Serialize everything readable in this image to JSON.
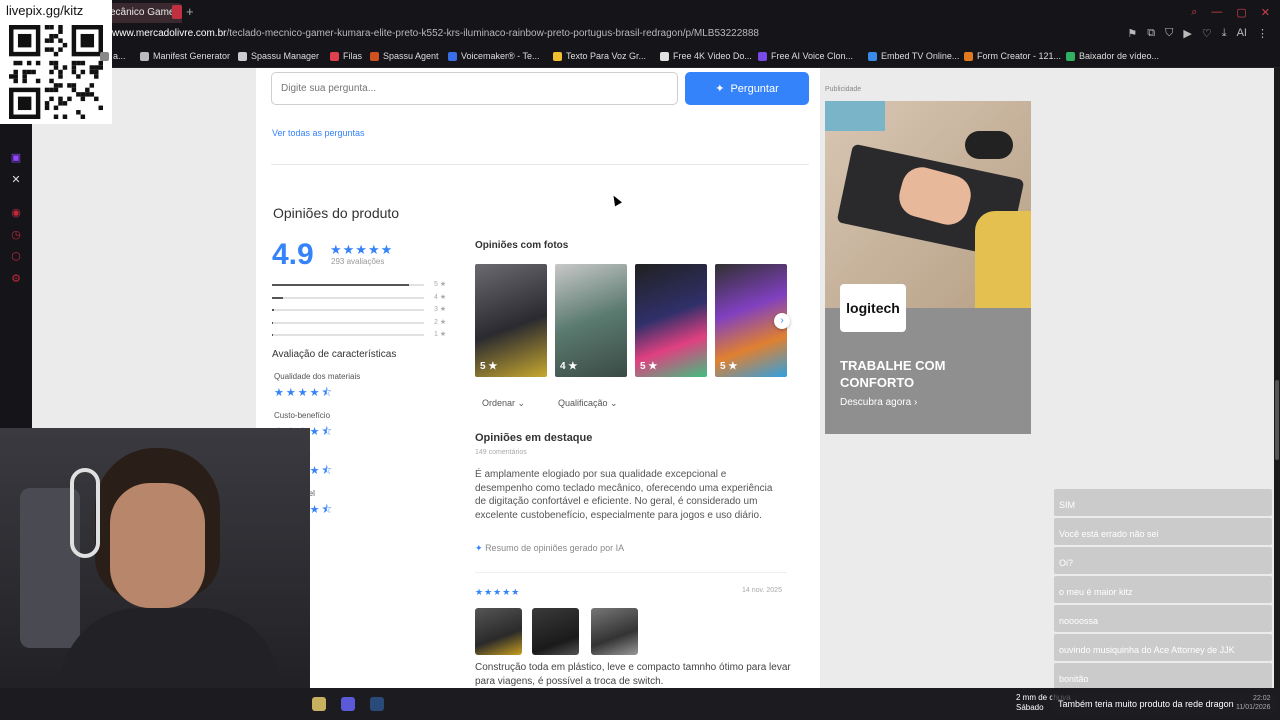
{
  "browser": {
    "tab_title": "ecânico Gamer |",
    "new_tab": "+",
    "url_host": "www.mercadolivre.com.br",
    "url_path": "/teclado-mecnico-gamer-kumara-elite-preto-k552-krs-iluminaco-rainbow-preto-portugus-brasil-redragon/p/MLB53222888",
    "ai_label": "AI",
    "bookmarks": [
      {
        "label": "a...",
        "color": "#888888"
      },
      {
        "label": "Manifest Generator",
        "color": "#bbbbbb"
      },
      {
        "label": "Spassu Manager",
        "color": "#cccccc"
      },
      {
        "label": "Filas",
        "color": "#e0404e"
      },
      {
        "label": "Spassu Agent",
        "color": "#d05020"
      },
      {
        "label": "Voicemaker® - Te...",
        "color": "#3a6ee8"
      },
      {
        "label": "Texto Para Voz Gr...",
        "color": "#f0c030"
      },
      {
        "label": "Free 4K Video Do...",
        "color": "#e0e0e0"
      },
      {
        "label": "Free AI Voice Clon...",
        "color": "#7a4ae8"
      },
      {
        "label": "Embed TV Online...",
        "color": "#3a8ae8"
      },
      {
        "label": "Form Creator - 121...",
        "color": "#e07a20"
      },
      {
        "label": "Baixador de vídeo...",
        "color": "#30b060"
      }
    ]
  },
  "stream": {
    "qr_label": "livepix.gg/kitz"
  },
  "questions": {
    "input_placeholder": "Digite sua pergunta...",
    "ask_button": "Perguntar",
    "see_all": "Ver todas as perguntas"
  },
  "opinions": {
    "title": "Opiniões do produto",
    "rating": "4.9",
    "stars": "★★★★★",
    "reviews_count": "293 avaliações",
    "distribution": [
      {
        "label": "5 ★",
        "share": 0.9
      },
      {
        "label": "4 ★",
        "share": 0.07
      },
      {
        "label": "3 ★",
        "share": 0.01
      },
      {
        "label": "2 ★",
        "share": 0.0
      },
      {
        "label": "1 ★",
        "share": 0.0
      }
    ],
    "characteristics_title": "Avaliação de características",
    "characteristics": [
      {
        "label": "Qualidade dos materiais",
        "stars": "★★★★⯪"
      },
      {
        "label": "Custo-benefício",
        "stars": "★★★★⯪"
      },
      {
        "label": "Silencioso",
        "stars": "★★★★⯪"
      },
      {
        "label": "Confortável",
        "stars": "★★★★⯪"
      }
    ],
    "photos_title": "Opiniões com fotos",
    "photos": [
      {
        "rating": "5 ★"
      },
      {
        "rating": "4 ★"
      },
      {
        "rating": "5 ★"
      },
      {
        "rating": "5 ★"
      }
    ],
    "next_arrow": "›",
    "sort_label": "Ordenar",
    "filter_label": "Qualificação",
    "featured_title": "Opiniões em destaque",
    "featured_count": "149 comentários",
    "summary": "É amplamente elogiado por sua qualidade excepcional e desempenho como teclado mecânico, oferecendo uma experiência de digitação confortável e eficiente. No geral, é considerado um excelente custobenefício, especialmente para jogos e uso diário.",
    "ai_note": "Resumo de opiniões gerado por IA",
    "review": {
      "stars": "★★★★★",
      "date": "14 nov. 2025",
      "text": "Construção toda em plástico, leve e compacto tamnho ótimo para levar para viagens, é possível a troca de switch."
    }
  },
  "ad": {
    "label": "Publicidade",
    "brand": "logitech",
    "headline": "TRABALHE COM CONFORTO",
    "cta": "Descubra agora"
  },
  "chat": [
    {
      "user": "",
      "msg": "SIM"
    },
    {
      "user": "",
      "msg": "Você está errado não sei"
    },
    {
      "user": "",
      "msg": "Oi?"
    },
    {
      "user": "",
      "msg": "o meu é maior kitz"
    },
    {
      "user": "",
      "msg": "noooossa"
    },
    {
      "user": "",
      "msg": "ouvindo musiquinha do Ace Attorney de JJK"
    },
    {
      "user": "",
      "msg": "bonitão"
    }
  ],
  "taskbar": {
    "weather": "2 mm de chuva",
    "weekday": "Sábado",
    "ticker": "Também teria muito produto da rede dragon",
    "time": "22:02",
    "date": "11/01/2026"
  }
}
